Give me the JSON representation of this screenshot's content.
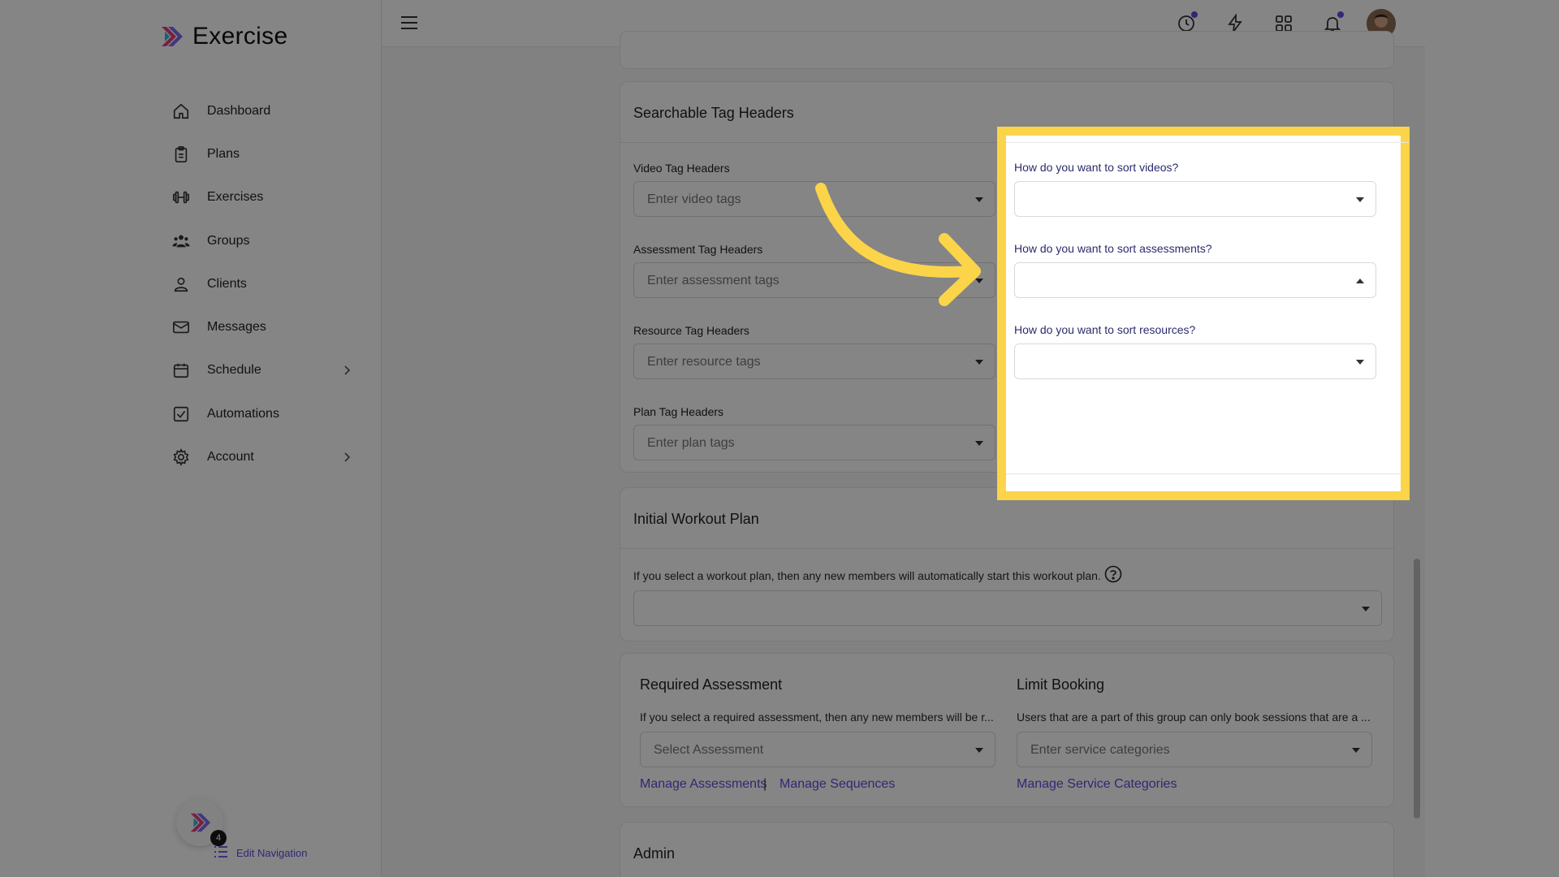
{
  "app": {
    "name": "Exercise"
  },
  "sidebar": {
    "items": [
      {
        "label": "Dashboard",
        "icon": "home-icon"
      },
      {
        "label": "Plans",
        "icon": "clipboard-icon"
      },
      {
        "label": "Exercises",
        "icon": "dumbbell-icon"
      },
      {
        "label": "Groups",
        "icon": "users-icon"
      },
      {
        "label": "Clients",
        "icon": "user-icon"
      },
      {
        "label": "Messages",
        "icon": "mail-icon"
      },
      {
        "label": "Schedule",
        "icon": "calendar-icon",
        "chevron": true
      },
      {
        "label": "Automations",
        "icon": "checkbox-icon"
      },
      {
        "label": "Account",
        "icon": "gear-icon",
        "chevron": true
      }
    ],
    "badge_count": "4",
    "edit_nav_label": "Edit Navigation"
  },
  "topbar": {
    "icons": [
      "history-icon",
      "bolt-icon",
      "apps-grid-icon",
      "bell-icon",
      "user-avatar"
    ]
  },
  "tags_card": {
    "title": "Searchable Tag Headers",
    "video": {
      "label": "Video Tag Headers",
      "placeholder": "Enter video tags"
    },
    "assessment": {
      "label": "Assessment Tag Headers",
      "placeholder": "Enter assessment tags"
    },
    "resource": {
      "label": "Resource Tag Headers",
      "placeholder": "Enter resource tags"
    },
    "plan": {
      "label": "Plan Tag Headers",
      "placeholder": "Enter plan tags"
    }
  },
  "sort_panel": {
    "videos_label": "How do you want to sort videos?",
    "assessments_label": "How do you want to sort assessments?",
    "resources_label": "How do you want to sort resources?"
  },
  "workout_card": {
    "title": "Initial Workout Plan",
    "description": "If you select a workout plan, then any new members will automatically start this workout plan."
  },
  "assessment_card": {
    "title": "Required Assessment",
    "description": "If you select a required assessment, then any new members will be r...",
    "placeholder": "Select Assessment",
    "link_assessments": "Manage Assessments",
    "separator": "|",
    "link_sequences": "Manage Sequences"
  },
  "booking_card": {
    "title": "Limit Booking",
    "description": "Users that are a part of this group can only book sessions that are a ...",
    "placeholder": "Enter service categories",
    "link": "Manage Service Categories"
  },
  "admin_card": {
    "title": "Admin"
  },
  "colors": {
    "accent": "#5b4ee0",
    "highlight": "#fbd449"
  }
}
